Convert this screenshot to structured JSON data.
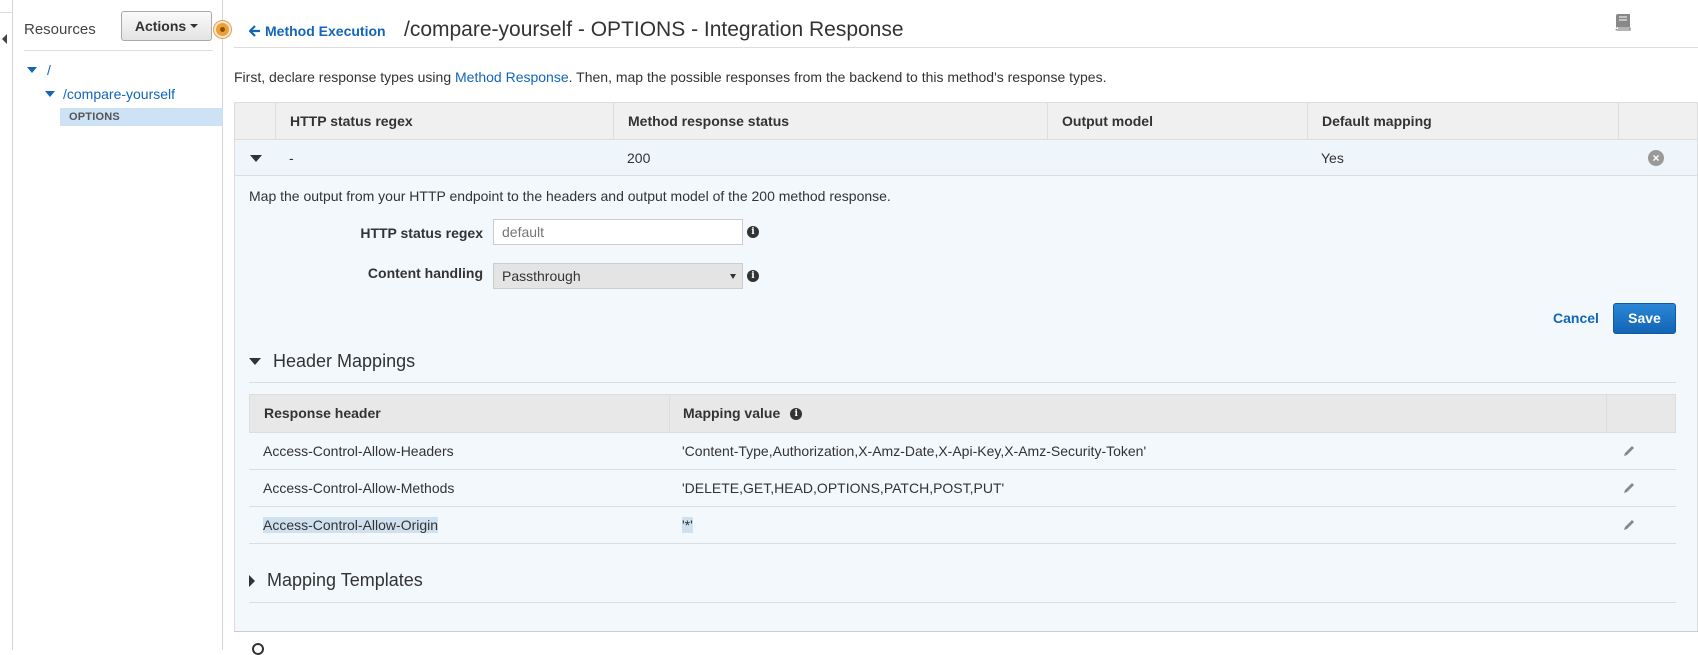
{
  "sidebar": {
    "title": "Resources",
    "actions_label": "Actions",
    "tree": {
      "root": "/",
      "child": "/compare-yourself",
      "method": "OPTIONS"
    }
  },
  "header": {
    "back_label": "Method Execution",
    "title": "/compare-yourself - OPTIONS - Integration Response"
  },
  "intro": {
    "prefix": "First, declare response types using ",
    "link": "Method Response",
    "suffix": ". Then, map the possible responses from the backend to this method's response types."
  },
  "responses_table": {
    "columns": [
      "HTTP status regex",
      "Method response status",
      "Output model",
      "Default mapping"
    ],
    "rows": [
      {
        "regex": "-",
        "status": "200",
        "model": "",
        "default": "Yes"
      }
    ]
  },
  "editor": {
    "description": "Map the output from your HTTP endpoint to the headers and output model of the 200 method response.",
    "regex_label": "HTTP status regex",
    "regex_placeholder": "default",
    "content_label": "Content handling",
    "content_value": "Passthrough",
    "cancel_label": "Cancel",
    "save_label": "Save"
  },
  "header_mappings": {
    "title": "Header Mappings",
    "columns": [
      "Response header",
      "Mapping value"
    ],
    "rows": [
      {
        "header": "Access-Control-Allow-Headers",
        "value": "'Content-Type,Authorization,X-Amz-Date,X-Api-Key,X-Amz-Security-Token'"
      },
      {
        "header": "Access-Control-Allow-Methods",
        "value": "'DELETE,GET,HEAD,OPTIONS,PATCH,POST,PUT'"
      },
      {
        "header": "Access-Control-Allow-Origin",
        "value": "'*'"
      }
    ]
  },
  "mapping_templates": {
    "title": "Mapping Templates"
  },
  "colors": {
    "link": "#1166bb",
    "selected_row": "#cde3f5",
    "primary_button": "#1a73c8",
    "accent_orange": "#f0a030"
  }
}
